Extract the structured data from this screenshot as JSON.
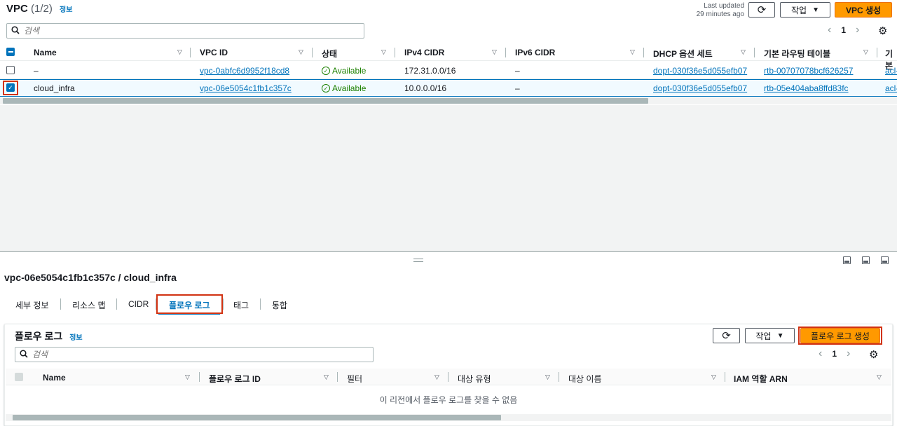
{
  "header": {
    "title": "VPC",
    "count": "(1/2)",
    "info": "정보",
    "last_updated_label": "Last updated",
    "last_updated_value": "29 minutes ago",
    "actions_label": "작업",
    "create_label": "VPC 생성",
    "search_placeholder": "검색",
    "page": "1"
  },
  "vpc_table": {
    "columns": [
      "Name",
      "VPC ID",
      "상태",
      "IPv4 CIDR",
      "IPv6 CIDR",
      "DHCP 옵션 세트",
      "기본 라우팅 테이블",
      "기본"
    ],
    "rows": [
      {
        "name": "–",
        "vpc_id": "vpc-0abfc6d9952f18cd8",
        "status": "Available",
        "ipv4": "172.31.0.0/16",
        "ipv6": "–",
        "dhcp": "dopt-030f36e5d055efb07",
        "route": "rtb-00707078bcf626257",
        "acl": "acl-"
      },
      {
        "name": "cloud_infra",
        "vpc_id": "vpc-06e5054c1fb1c357c",
        "status": "Available",
        "ipv4": "10.0.0.0/16",
        "ipv6": "–",
        "dhcp": "dopt-030f36e5d055efb07",
        "route": "rtb-05e404aba8ffd83fc",
        "acl": "acl-"
      }
    ],
    "scroll_position": 0.72
  },
  "detail": {
    "title": "vpc-06e5054c1fb1c357c / cloud_infra",
    "tabs": [
      "세부 정보",
      "리소스 맵",
      "CIDR",
      "플로우 로그",
      "태그",
      "통합"
    ],
    "active_tab": "플로우 로그"
  },
  "flow_logs": {
    "title": "플로우 로그",
    "info": "정보",
    "actions_label": "작업",
    "create_label": "플로우 로그 생성",
    "search_placeholder": "검색",
    "page": "1",
    "columns": [
      "Name",
      "플로우 로그 ID",
      "필터",
      "대상 유형",
      "대상 이름",
      "IAM 역할 ARN"
    ],
    "empty_message": "이 리전에서 플로우 로그를 찾을 수 없음",
    "scroll_position": 0.55
  },
  "colors": {
    "primary": "#ff9900",
    "link": "#0073bb",
    "success": "#1d8102",
    "highlight": "#d13212"
  }
}
